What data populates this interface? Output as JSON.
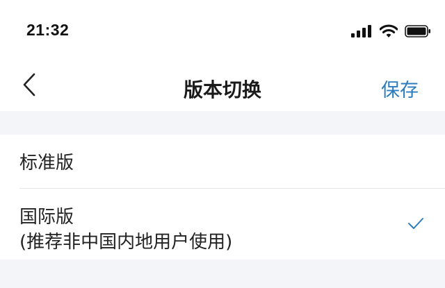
{
  "status_bar": {
    "time": "21:32",
    "icons": [
      "signal-icon",
      "wifi-icon",
      "battery-icon"
    ]
  },
  "nav": {
    "back_icon": "chevron-left-icon",
    "title": "版本切换",
    "save_label": "保存"
  },
  "options": [
    {
      "label": "标准版",
      "sublabel": "",
      "selected": false
    },
    {
      "label": "国际版",
      "sublabel": "(推荐非中国内地用户使用)",
      "selected": true
    }
  ],
  "colors": {
    "accent": "#2b7bbd",
    "background": "#f4f5f9",
    "surface": "#ffffff",
    "check": "#2b7bbd"
  }
}
